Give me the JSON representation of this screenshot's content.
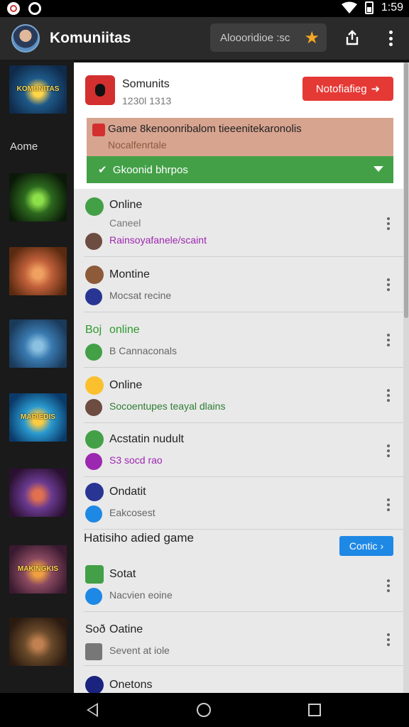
{
  "status_bar": {
    "time": "1:59"
  },
  "app_bar": {
    "title": "Komuniitas",
    "search_placeholder": "Aloooridioe :sc"
  },
  "sidebar": {
    "label": "Aome",
    "thumbnails": [
      {
        "caption": "KOMUNITAS",
        "colors": [
          "#0f2a4a",
          "#1e5a8a",
          "#ffd54a"
        ]
      },
      {
        "caption": "",
        "colors": [
          "#0b1a08",
          "#2d6a1e",
          "#8ee04a"
        ]
      },
      {
        "caption": "",
        "colors": [
          "#5a2a10",
          "#c0603a",
          "#f0a060"
        ]
      },
      {
        "caption": "",
        "colors": [
          "#1a3a5a",
          "#3a7ab0",
          "#8ac0e0"
        ]
      },
      {
        "caption": "MARIEDIS",
        "colors": [
          "#0a3a6a",
          "#2a9ad0",
          "#ffcc40"
        ]
      },
      {
        "caption": "",
        "colors": [
          "#2a1030",
          "#6a3a90",
          "#e07050"
        ]
      },
      {
        "caption": "MAKINGKIS",
        "colors": [
          "#3a1a30",
          "#8a4a60",
          "#f0a040"
        ]
      },
      {
        "caption": "",
        "colors": [
          "#2a1a10",
          "#6a4a2a",
          "#c08050"
        ]
      }
    ]
  },
  "card": {
    "title": "Somunits",
    "subtitle": "1230l 1313",
    "notify_label": "Notofiafieg",
    "banner_line1": "Game 8kenoonribalom tieeenitekaronolis",
    "banner_line2": "Nocalfenrtale",
    "green_button_label": "Gkoonid bhrpos"
  },
  "list": [
    {
      "line1": "Online",
      "line2": "Caneel",
      "line3": "Rainsoyafanele/scaint",
      "icon1_color": "#43a047",
      "icon2_color": "#6d4c41",
      "line1_color": "#222",
      "line3_color": "#9c27b0"
    },
    {
      "line1": "Montine",
      "line2": "Mocsat recine",
      "icon1_color": "#8d5a3a",
      "icon2_color": "#283593",
      "line1_color": "#222",
      "line2_color": "#666"
    },
    {
      "line1_prefix": "Boj",
      "line1": "online",
      "line2": "B Cannaconals",
      "icon1_color": "#43a047",
      "icon2_color": "#43a047",
      "line1_color": "#2e9a2e",
      "line2_color": "#666"
    },
    {
      "line1": "Online",
      "line2": "Socoentupes teayal dlains",
      "icon1_color": "#fbc02d",
      "icon2_color": "#6d4c41",
      "line1_color": "#222",
      "line2_color": "#2e7d32"
    },
    {
      "line1": "Acstatin nudult",
      "line2": "S3 socd rao",
      "icon1_color": "#43a047",
      "icon2_color": "#9c27b0",
      "line1_color": "#222",
      "line2_color": "#9c27b0"
    },
    {
      "line1": "Ondatit",
      "line2": "Eakcosest",
      "icon1_color": "#283593",
      "icon2_color": "#1e88e5",
      "line1_color": "#222",
      "line2_color": "#666"
    }
  ],
  "section": {
    "title": "Hatisiho adied game",
    "button_label": "Contic"
  },
  "list2": [
    {
      "line1": "Sotat",
      "line2": "Nacvien eoine",
      "icon1_color": "#43a047",
      "icon2_color": "#1e88e5"
    },
    {
      "line1_prefix": "Soð",
      "line1": "Oatine",
      "line2": "Sevent at iole",
      "icon1_color": "#b71c1c",
      "icon2_color": "#666"
    },
    {
      "line1": "Onetons",
      "line2": "",
      "icon1_color": "#1a237e",
      "icon2_color": "#888"
    }
  ]
}
